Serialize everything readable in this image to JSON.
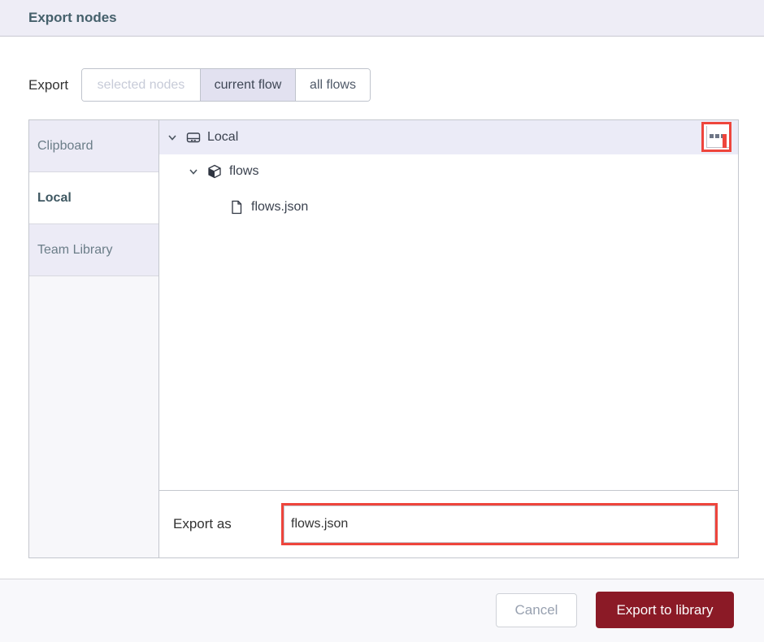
{
  "dialog": {
    "title": "Export nodes"
  },
  "export_selector": {
    "label": "Export",
    "options": [
      {
        "label": "selected nodes",
        "state": "disabled"
      },
      {
        "label": "current flow",
        "state": "selected"
      },
      {
        "label": "all flows",
        "state": "default"
      }
    ]
  },
  "library_browser": {
    "tabs": [
      {
        "label": "Clipboard",
        "selected": false
      },
      {
        "label": "Local",
        "selected": true
      },
      {
        "label": "Team Library",
        "selected": false
      }
    ],
    "tree": {
      "root": {
        "label": "Local",
        "icon": "hard-drive-icon",
        "expanded": true
      },
      "folder": {
        "label": "flows",
        "icon": "package-icon",
        "expanded": true
      },
      "file": {
        "label": "flows.json",
        "icon": "file-icon"
      }
    },
    "menu_button": {
      "icon": "ellipsis-icon",
      "highlighted": true
    },
    "export_as": {
      "label": "Export as",
      "value": "flows.json",
      "highlighted": true
    }
  },
  "footer": {
    "cancel_label": "Cancel",
    "primary_label": "Export to library"
  },
  "colors": {
    "highlight_red": "#ee453c",
    "primary_button": "#8b1a26",
    "header_bg": "#eeedf6",
    "selected_segment_bg": "#e2e1f0",
    "tree_header_bg": "#ebebf7",
    "sidebar_tab_bg": "#ecebf6",
    "title_text": "#45606b"
  }
}
